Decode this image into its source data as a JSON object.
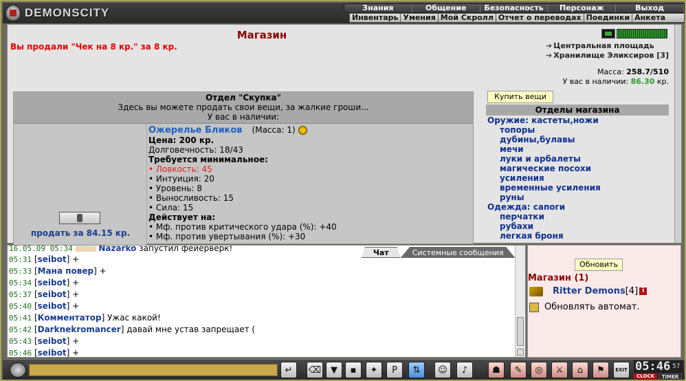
{
  "header": {
    "site_name": "DEMONSCITY",
    "menu_top": [
      "Знания",
      "Общение",
      "Безопасность",
      "Персонаж",
      "Выход"
    ],
    "menu_sub": [
      "Инвентарь",
      "Умения",
      "Мой Скролл",
      "Отчет о переводах",
      "Поединки",
      "Анкета"
    ]
  },
  "shop": {
    "title": "Магазин",
    "sold_message": "Вы продали \"Чек на 8 кр.\" за 8 кр.",
    "nav_links": [
      "Центральная площадь",
      "Хранилище Эликсиров [3]"
    ],
    "mass_label": "Масса:",
    "mass_value": "258.7/510",
    "have_label": "У вас в наличии:",
    "have_value": "86.30",
    "have_unit": "кр.",
    "buy_button": "Купить вещи",
    "departments_title": "Отделы магазина",
    "categories": [
      {
        "label": "Оружие: кастеты,ножи",
        "level": "top"
      },
      {
        "label": "топоры",
        "level": "sub"
      },
      {
        "label": "дубины,булавы",
        "level": "sub"
      },
      {
        "label": "мечи",
        "level": "sub"
      },
      {
        "label": "луки и арбалеты",
        "level": "sub"
      },
      {
        "label": "магические посохи",
        "level": "sub"
      },
      {
        "label": "усиления",
        "level": "sub"
      },
      {
        "label": "временные усиления",
        "level": "sub"
      },
      {
        "label": "руны",
        "level": "sub"
      },
      {
        "label": "Одежда: сапоги",
        "level": "top"
      },
      {
        "label": "перчатки",
        "level": "sub"
      },
      {
        "label": "рубахи",
        "level": "sub"
      },
      {
        "label": "легкая броня",
        "level": "sub"
      }
    ]
  },
  "department": {
    "title": "Отдел \"Скупка\"",
    "subtitle": "Здесь вы можете продать свои вещи, за жалкие гроши...",
    "subtitle2": "У вас в наличии:"
  },
  "item": {
    "name": "Ожерелье Бликов",
    "mass": "(Масса: 1)",
    "price": "Цена: 200 кр.",
    "durability": "Долговечность: 18/43",
    "req_title": "Требуется минимальное:",
    "requirements": [
      "• Ловкость: 45",
      "• Интуиция: 20",
      "• Уровень: 8",
      "• Выносливость: 15",
      "• Сила: 15"
    ],
    "effects_title": "Действует на:",
    "effects": [
      "• Мф. против критического удара (%): +40",
      "• Мф. против увертывания (%): +30"
    ],
    "sell_link": "продать за 84.15 кр."
  },
  "chat": {
    "tabs": [
      "Чат",
      "Системные сообщения"
    ],
    "partial_line": "16.05.09 05:34",
    "partial_nick": "Nazarko",
    "partial_text": " запустил фейерверк!",
    "lines": [
      {
        "time": "05:31",
        "nick": "seibot",
        "text": " +"
      },
      {
        "time": "05:33",
        "nick": "Мана повер",
        "text": " +"
      },
      {
        "time": "05:34",
        "nick": "seibot",
        "text": " +"
      },
      {
        "time": "05:37",
        "nick": "seibot",
        "text": " +"
      },
      {
        "time": "05:40",
        "nick": "seibot",
        "text": " +"
      },
      {
        "time": "05:41",
        "nick": "Комментатор",
        "text": " Ужас какой!"
      },
      {
        "time": "05:42",
        "nick": "Darknekromancer",
        "text": " давай мне устав запрещает ("
      },
      {
        "time": "05:43",
        "nick": "seibot",
        "text": " +"
      },
      {
        "time": "05:46",
        "nick": "seibot",
        "text": " +"
      }
    ]
  },
  "online": {
    "refresh_button": "Обновить",
    "title": "Магазин (1)",
    "user_nick": "Ritter Demons",
    "user_level": "[4]",
    "info_icon": "i",
    "auto_refresh": "Обновлять автомат."
  },
  "toolbar": {
    "time": "05:46",
    "seconds": "57",
    "clock_label": "CLOCK",
    "timer_label": "TIMER",
    "exit_label": "EXIT"
  }
}
